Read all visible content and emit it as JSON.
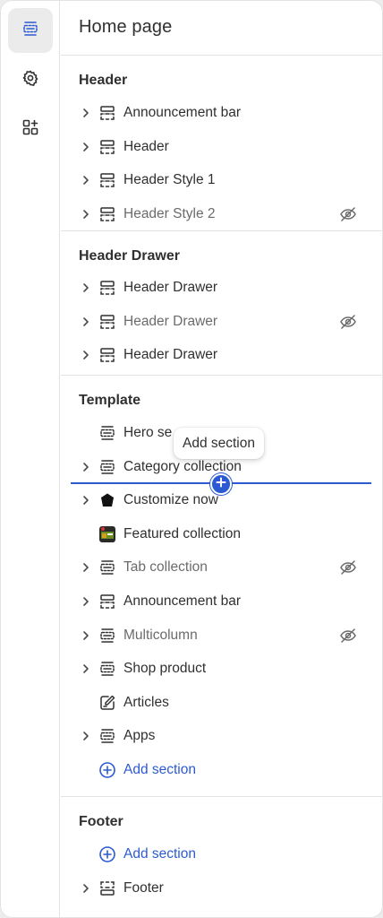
{
  "page": {
    "title": "Home page"
  },
  "colors": {
    "accent": "#2c5ad1",
    "text": "#303030",
    "muted": "#6b6b6b"
  },
  "rail": [
    {
      "name": "sections",
      "icon": "sections-icon",
      "active": true
    },
    {
      "name": "settings",
      "icon": "gear-icon",
      "active": false
    },
    {
      "name": "apps",
      "icon": "add-apps-icon",
      "active": false
    }
  ],
  "groups": {
    "header": {
      "title": "Header",
      "items": [
        {
          "label": "Announcement bar",
          "icon": "header-section-icon",
          "chevron": true,
          "hidden": false
        },
        {
          "label": "Header",
          "icon": "header-section-icon",
          "chevron": true,
          "hidden": false
        },
        {
          "label": "Header Style 1",
          "icon": "header-section-icon",
          "chevron": true,
          "hidden": false
        },
        {
          "label": "Header Style 2",
          "icon": "header-section-icon",
          "chevron": true,
          "hidden": true
        }
      ]
    },
    "header_drawer": {
      "title": "Header Drawer",
      "items": [
        {
          "label": "Header Drawer",
          "icon": "header-section-icon",
          "chevron": true,
          "hidden": false
        },
        {
          "label": "Header Drawer",
          "icon": "header-section-icon",
          "chevron": true,
          "hidden": true
        },
        {
          "label": "Header Drawer",
          "icon": "header-section-icon",
          "chevron": true,
          "hidden": false
        }
      ]
    },
    "template": {
      "title": "Template",
      "items": [
        {
          "label": "Hero se",
          "icon": "section-icon",
          "chevron": false,
          "hidden": false
        },
        {
          "label": "Category collection",
          "icon": "section-icon",
          "chevron": true,
          "hidden": false
        },
        {
          "label": "Customize now",
          "icon": "pentagon-icon",
          "chevron": true,
          "hidden": false
        },
        {
          "label": "Featured collection",
          "icon": "app-thumbnail-icon",
          "chevron": false,
          "hidden": false
        },
        {
          "label": "Tab collection",
          "icon": "section-icon",
          "chevron": true,
          "hidden": true
        },
        {
          "label": "Announcement bar",
          "icon": "header-section-icon",
          "chevron": true,
          "hidden": false
        },
        {
          "label": "Multicolumn",
          "icon": "section-icon",
          "chevron": true,
          "hidden": true
        },
        {
          "label": "Shop product",
          "icon": "section-icon",
          "chevron": true,
          "hidden": false
        },
        {
          "label": "Articles",
          "icon": "edit-icon",
          "chevron": false,
          "hidden": false
        },
        {
          "label": "Apps",
          "icon": "section-icon",
          "chevron": true,
          "hidden": false
        }
      ],
      "add_label": "Add section"
    },
    "footer": {
      "title": "Footer",
      "add_label": "Add section",
      "items": [
        {
          "label": "Footer",
          "icon": "footer-section-icon",
          "chevron": true,
          "hidden": false
        }
      ]
    }
  },
  "tooltip": {
    "label": "Add section"
  }
}
